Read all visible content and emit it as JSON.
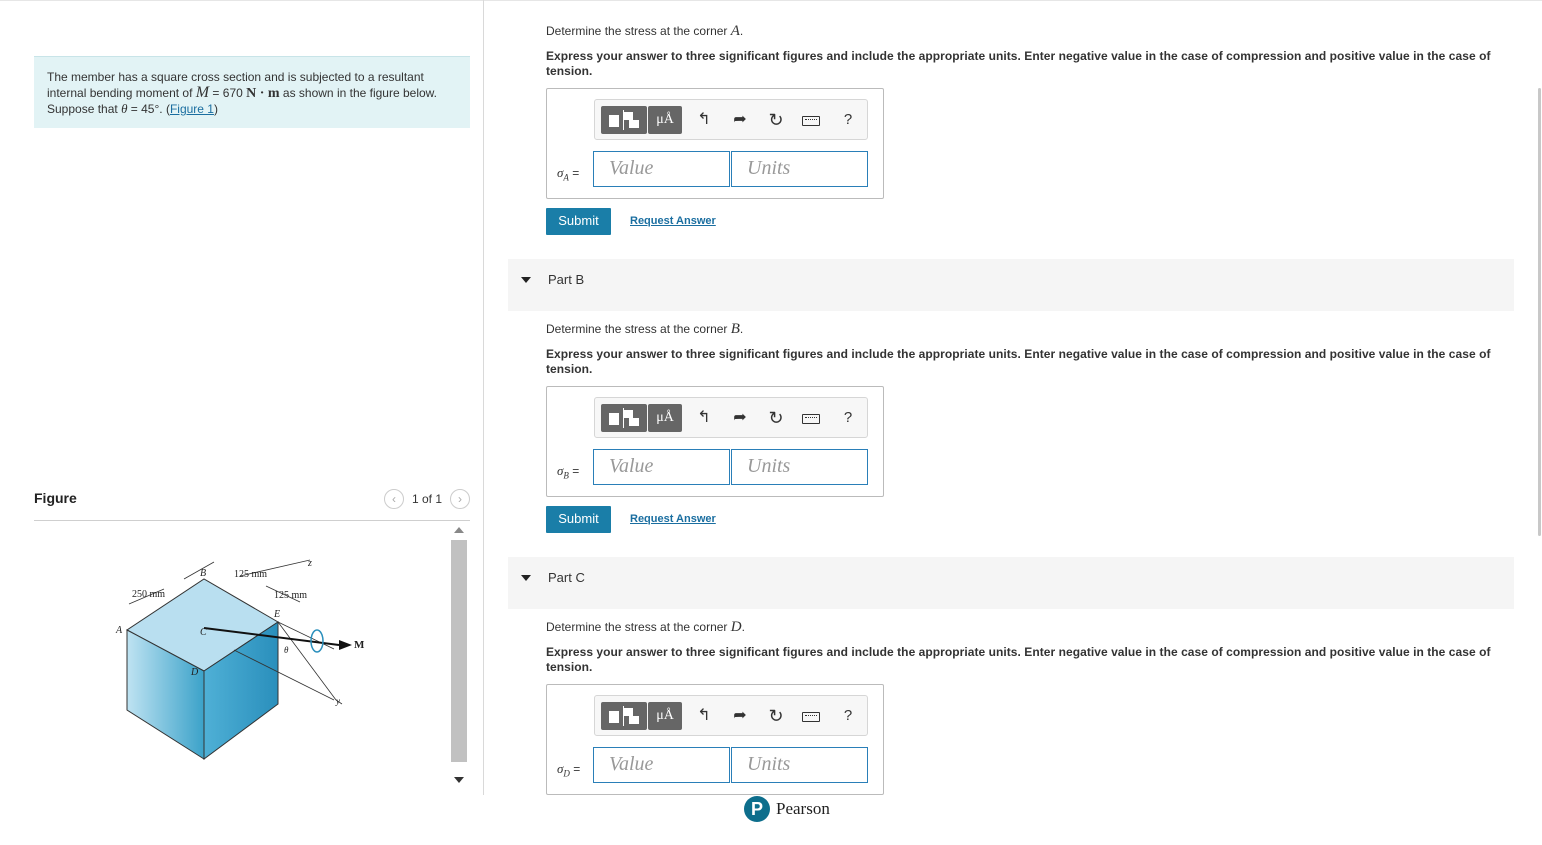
{
  "problem": {
    "line1": "The member has a square cross section and is subjected to a resultant",
    "line2_pre": "internal bending moment of ",
    "moment_symbol": "M",
    "moment_eq": " = 670 ",
    "moment_units": "N · m",
    "line2_post": " as shown in the figure below.",
    "line3_pre": "Suppose that ",
    "theta_symbol": "θ",
    "theta_value": " = 45°",
    "line3_sep": ". (",
    "figure_link": "Figure 1",
    "line3_end": ")"
  },
  "figure": {
    "title": "Figure",
    "pager": "1 of 1",
    "prev_icon": "‹",
    "next_icon": "›",
    "labels": {
      "b": "B",
      "dim1": "125 mm",
      "z": "z",
      "dim2": "250 mm",
      "dim3": "125 mm",
      "e": "E",
      "a": "A",
      "c": "C",
      "m": "M",
      "theta": "θ",
      "d": "D",
      "y": "y"
    }
  },
  "toolbar": {
    "units_btn": "μÅ",
    "undo_icon": "undo-icon",
    "redo_icon": "redo-icon",
    "reset_icon": "reset-icon",
    "keyboard_icon": "keyboard-icon",
    "help": "?"
  },
  "inputs": {
    "value_placeholder": "Value",
    "units_placeholder": "Units"
  },
  "buttons": {
    "submit": "Submit",
    "request": "Request Answer"
  },
  "parts": [
    {
      "label": "",
      "prompt_pre": "Determine the stress at the corner ",
      "corner": "A",
      "instruction": "Express your answer to three significant figures and include the appropriate units. Enter negative value in the case of compression and positive value in the case of tension.",
      "sigma": "σ",
      "sigma_sub": "A",
      "eq": " ="
    },
    {
      "label": "Part B",
      "prompt_pre": "Determine the stress at the corner ",
      "corner": "B",
      "instruction": "Express your answer to three significant figures and include the appropriate units. Enter negative value in the case of compression and positive value in the case of tension.",
      "sigma": "σ",
      "sigma_sub": "B",
      "eq": " ="
    },
    {
      "label": "Part C",
      "prompt_pre": "Determine the stress at the corner ",
      "corner": "D",
      "instruction": "Express your answer to three significant figures and include the appropriate units. Enter negative value in the case of compression and positive value in the case of tension.",
      "sigma": "σ",
      "sigma_sub": "D",
      "eq": " ="
    }
  ],
  "footer": {
    "brand": "Pearson",
    "logo_letter": "P"
  }
}
